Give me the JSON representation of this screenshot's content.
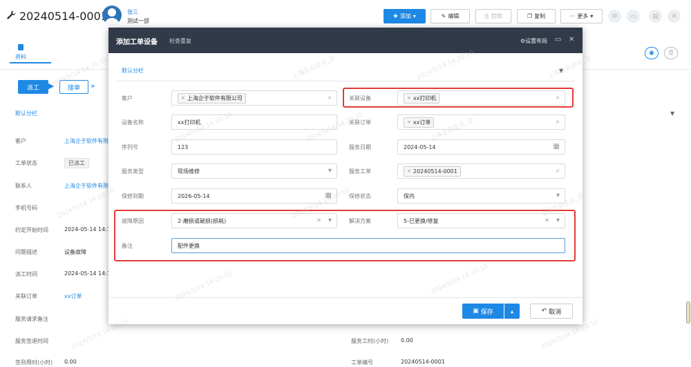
{
  "header": {
    "order_number": "20240514-0001",
    "user_name": "张三",
    "user_dept": "测试一部",
    "buttons": {
      "add": "添加",
      "edit": "编辑",
      "print": "打印",
      "copy": "复制",
      "more": "更多"
    }
  },
  "page": {
    "tab_label": "资料",
    "steps": [
      "派工",
      "接单"
    ],
    "section_label": "默认分栏",
    "rows": [
      {
        "label": "客户",
        "value": "上海企于软件有限",
        "link": true
      },
      {
        "label": "工单状态",
        "value": "已派工",
        "badge": true
      },
      {
        "label": "联系人",
        "value": "上海企于软件有限",
        "link": true
      },
      {
        "label": "手机号码",
        "value": ""
      },
      {
        "label": "约定开始时间",
        "value": "2024-05-14 14:1"
      },
      {
        "label": "问题描述",
        "value": "设备故障"
      },
      {
        "label": "派工时间",
        "value": "2024-05-14 14:1"
      },
      {
        "label": "关联订单",
        "value": "xx订单",
        "link": true
      },
      {
        "label": "服务请求备注",
        "value": ""
      },
      {
        "label": "服务签退时间",
        "value": ""
      },
      {
        "label": "签到用时(小时)",
        "value": "0.00"
      }
    ],
    "bottom_right": [
      {
        "label": "服务工时(小时)",
        "value": "0.00"
      },
      {
        "label": "工单编号",
        "value": "20240514-0001"
      }
    ]
  },
  "dialog": {
    "title": "添加工单设备",
    "subtitle": "检查重复",
    "layout_label": "设置布局",
    "section_label": "默认分栏",
    "fields": {
      "customer": {
        "label": "客户",
        "tag": "上海企于软件有限公司"
      },
      "device": {
        "label": "关联设备",
        "tag": "xx打印机"
      },
      "device_name": {
        "label": "设备名称",
        "value": "xx打印机"
      },
      "order": {
        "label": "关联订单",
        "tag": "xx订单"
      },
      "serial": {
        "label": "序列号",
        "value": "123"
      },
      "service_date": {
        "label": "服务日期",
        "value": "2024-05-14"
      },
      "service_type": {
        "label": "服务类型",
        "value": "现场维修"
      },
      "service_ticket": {
        "label": "服务工单",
        "tag": "20240514-0001"
      },
      "warranty_expiry": {
        "label": "保修到期",
        "value": "2026-05-14"
      },
      "warranty_status": {
        "label": "保修状态",
        "value": "保内"
      },
      "fault_reason": {
        "label": "故障原因",
        "value": "2-磨损或破损(损耗)"
      },
      "solution": {
        "label": "解决方案",
        "value": "5-已更换/修复"
      },
      "remark": {
        "label": "备注",
        "value": "配件更换"
      }
    },
    "save_label": "保存",
    "cancel_label": "取消"
  },
  "watermark": "2024/5/14 14:20:10",
  "watermark_company": "上海企云企业_企"
}
